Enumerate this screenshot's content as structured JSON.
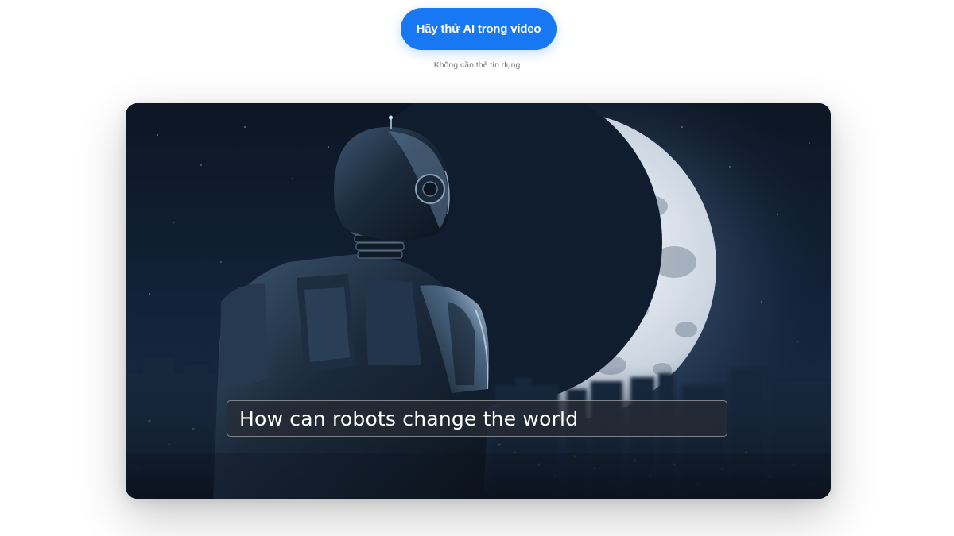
{
  "cta": {
    "button_label": "Hãy thử AI trong video",
    "subtext": "Không cần thẻ tín dụng"
  },
  "video": {
    "caption": "How can robots change the world"
  },
  "colors": {
    "accent": "#1877f2",
    "caption_bg": "#282c34",
    "night_sky": "#0d1726"
  }
}
